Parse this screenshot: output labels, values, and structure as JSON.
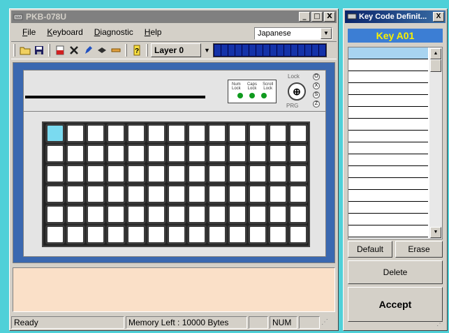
{
  "main_window": {
    "title": "PKB-078U",
    "buttons": {
      "minimize": "_",
      "restore": "□",
      "close": "X"
    }
  },
  "menu": {
    "items": [
      {
        "label": "File",
        "accel": "F",
        "rest": "ile"
      },
      {
        "label": "Keyboard",
        "accel": "K",
        "rest": "eyboard"
      },
      {
        "label": "Diagnostic",
        "accel": "D",
        "rest": "iagnostic"
      },
      {
        "label": "Help",
        "accel": "H",
        "rest": "elp"
      }
    ]
  },
  "language_select": {
    "value": "Japanese"
  },
  "toolbar": {
    "icons": [
      "open-folder-icon",
      "save-disk-icon",
      "cut-icon",
      "delete-x-icon",
      "pen-icon",
      "diamond-icon",
      "dash-icon",
      "help-icon"
    ],
    "layer_value": "Layer 0",
    "led_segments": 16
  },
  "keyboard": {
    "rows": 6,
    "cols": 13,
    "selected_key": [
      0,
      0
    ],
    "indicators": {
      "labels": [
        [
          "Num",
          "Lock"
        ],
        [
          "Caps",
          "Lock"
        ],
        [
          "Scroll",
          "Lock"
        ]
      ]
    },
    "lock": {
      "top_label": "Lock",
      "bottom_label": "PRG",
      "positions": [
        "O",
        "X",
        "S",
        "Z"
      ]
    }
  },
  "status_bar": {
    "ready": "Ready",
    "memory": "Memory Left : 10000 Bytes",
    "num": "NUM"
  },
  "key_code_window": {
    "title": "Key Code Definit...",
    "close": "X",
    "key_name": "Key A01",
    "list_rows": 16,
    "buttons": {
      "default": "Default",
      "erase": "Erase",
      "delete": "Delete",
      "accept": "Accept"
    }
  },
  "colors": {
    "selected_key": "#7adaf0",
    "key_header_bg": "#3c7ed4",
    "key_header_text": "#f8f000",
    "message_area": "#fae0c8",
    "led_green": "#0f9a1e"
  }
}
